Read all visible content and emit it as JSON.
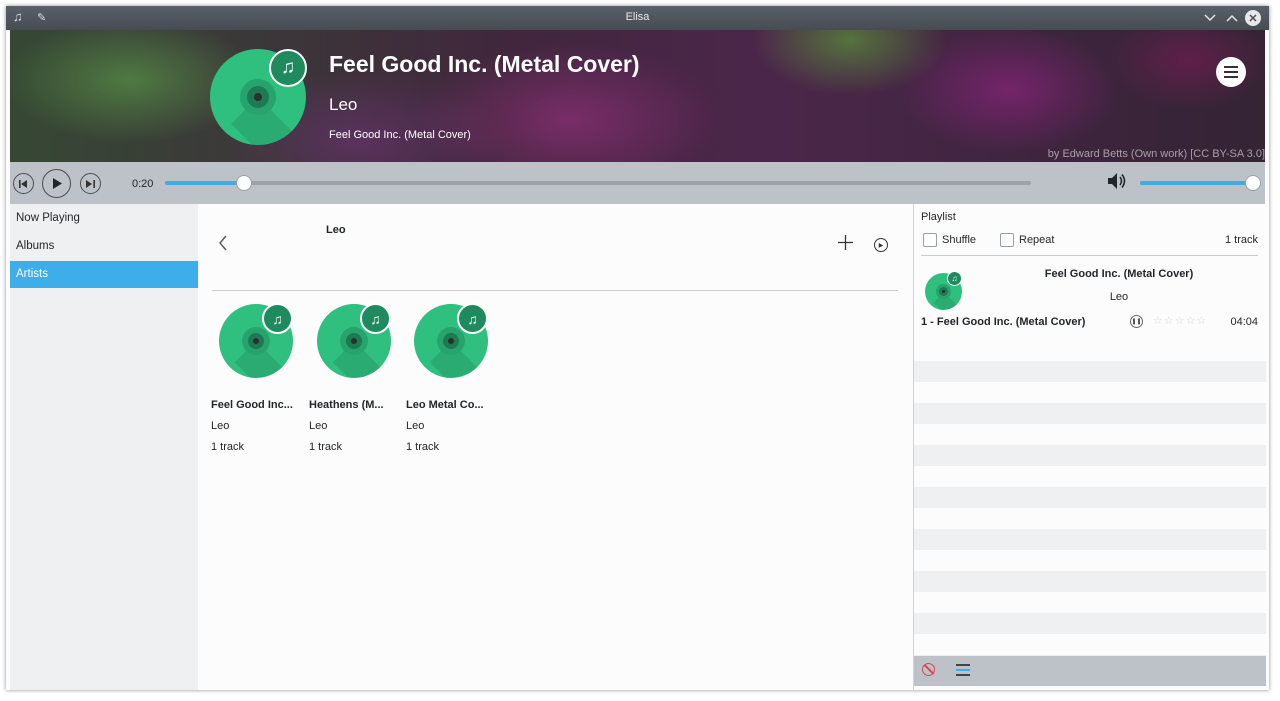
{
  "window": {
    "title": "Elisa"
  },
  "header": {
    "title": "Feel Good Inc. (Metal Cover)",
    "artist": "Leo",
    "album": "Feel Good Inc. (Metal Cover)",
    "credit": "by Edward Betts (Own work) [CC BY-SA 3.0]"
  },
  "transport": {
    "elapsed": "0:20",
    "progress": 0.09,
    "volume": 1.0
  },
  "sidebar": {
    "items": [
      {
        "label": "Now Playing"
      },
      {
        "label": "Albums"
      },
      {
        "label": "Artists",
        "active": true
      }
    ]
  },
  "content": {
    "title": "Leo",
    "albums": [
      {
        "name": "Feel Good Inc...",
        "artist": "Leo",
        "count": "1 track"
      },
      {
        "name": "Heathens (M...",
        "artist": "Leo",
        "count": "1 track"
      },
      {
        "name": "Leo Metal Co...",
        "artist": "Leo",
        "count": "1 track"
      }
    ]
  },
  "playlist": {
    "heading": "Playlist",
    "shuffle_label": "Shuffle",
    "repeat_label": "Repeat",
    "count": "1 track",
    "current_title": "Feel Good Inc. (Metal Cover)",
    "current_artist": "Leo",
    "track_label": "1 - Feel Good Inc. (Metal Cover)",
    "duration": "04:04",
    "rating": 0
  },
  "colors": {
    "accent": "#3daee9",
    "album_art": "#2fbf7f",
    "header_text": "#ffffff"
  },
  "icons": [
    "music-note-icon",
    "pin-icon",
    "minimize-icon",
    "maximize-icon",
    "close-icon",
    "hamburger-menu-icon",
    "previous-icon",
    "play-icon",
    "next-icon",
    "volume-icon",
    "back-arrow-icon",
    "add-icon",
    "play-circle-icon",
    "pause-icon",
    "star-icon",
    "clear-playlist-icon",
    "show-playing-track-icon"
  ]
}
